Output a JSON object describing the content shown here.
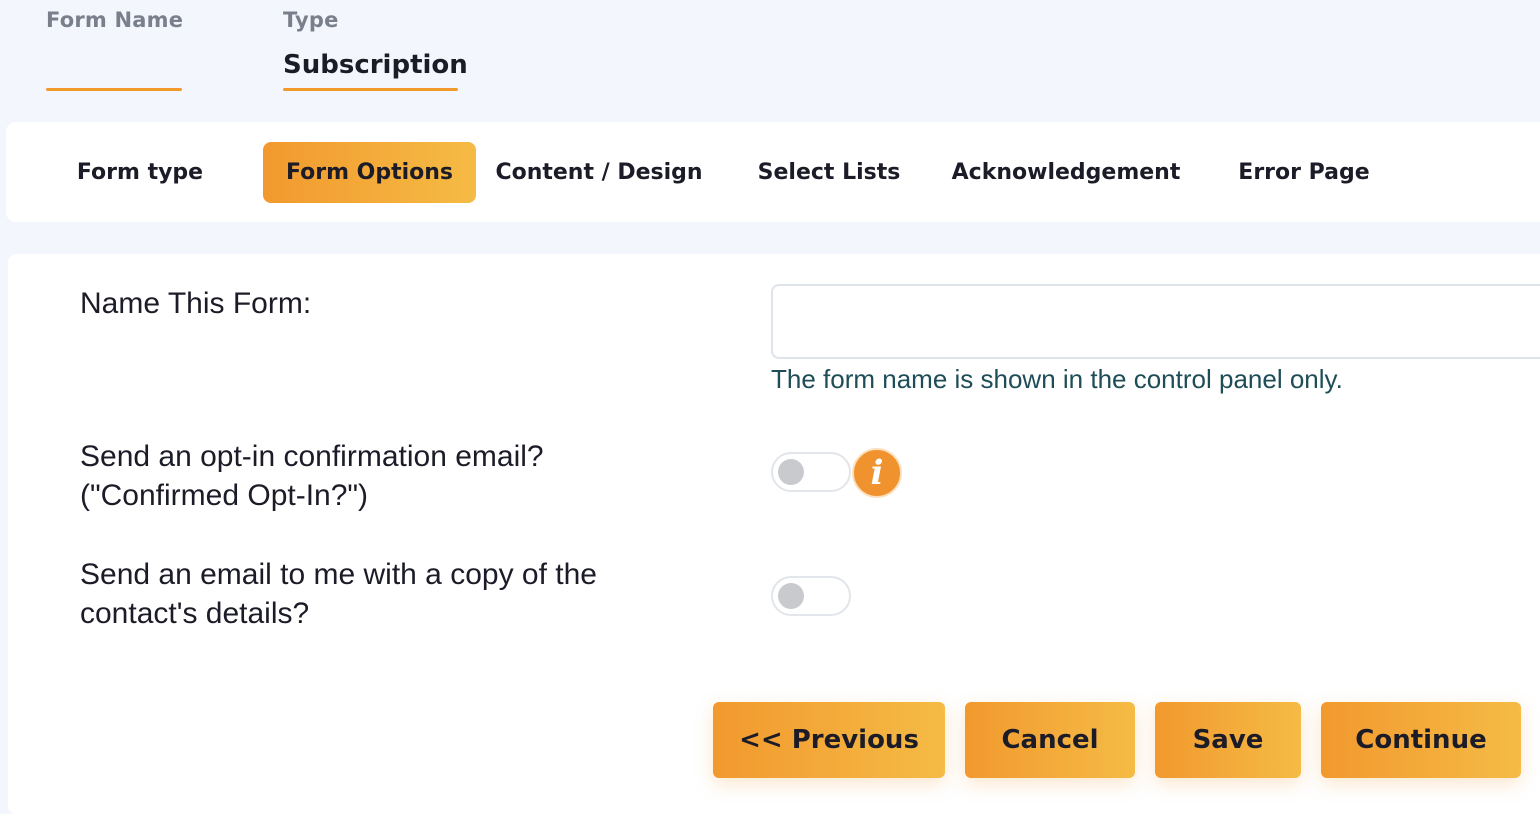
{
  "header": {
    "form_name_label": "Form Name",
    "form_name_value": "",
    "type_label": "Type",
    "type_value": "Subscription"
  },
  "tabs": [
    {
      "label": "Form type",
      "active": false
    },
    {
      "label": "Form Options",
      "active": true
    },
    {
      "label": "Content / Design",
      "active": false
    },
    {
      "label": "Select Lists",
      "active": false
    },
    {
      "label": "Acknowledgement",
      "active": false
    },
    {
      "label": "Error Page",
      "active": false
    }
  ],
  "form": {
    "name_label": "Name This Form:",
    "name_value": "",
    "name_hint": "The form name is shown in the control panel only.",
    "optin_label_line1": "Send an opt-in confirmation email?",
    "optin_label_line2": "(\"Confirmed Opt-In?\")",
    "optin_enabled": false,
    "copy_label_line1": "Send an email to me with a copy of the",
    "copy_label_line2": "contact's details?",
    "copy_enabled": false,
    "info_icon_glyph": "i"
  },
  "buttons": {
    "previous": "<< Previous",
    "cancel": "Cancel",
    "save": "Save",
    "continue": "Continue"
  },
  "colors": {
    "accent": "#f2992e",
    "accent_light": "#f5bb45",
    "hint_text": "#1e4d57",
    "background": "#f3f6fc"
  }
}
